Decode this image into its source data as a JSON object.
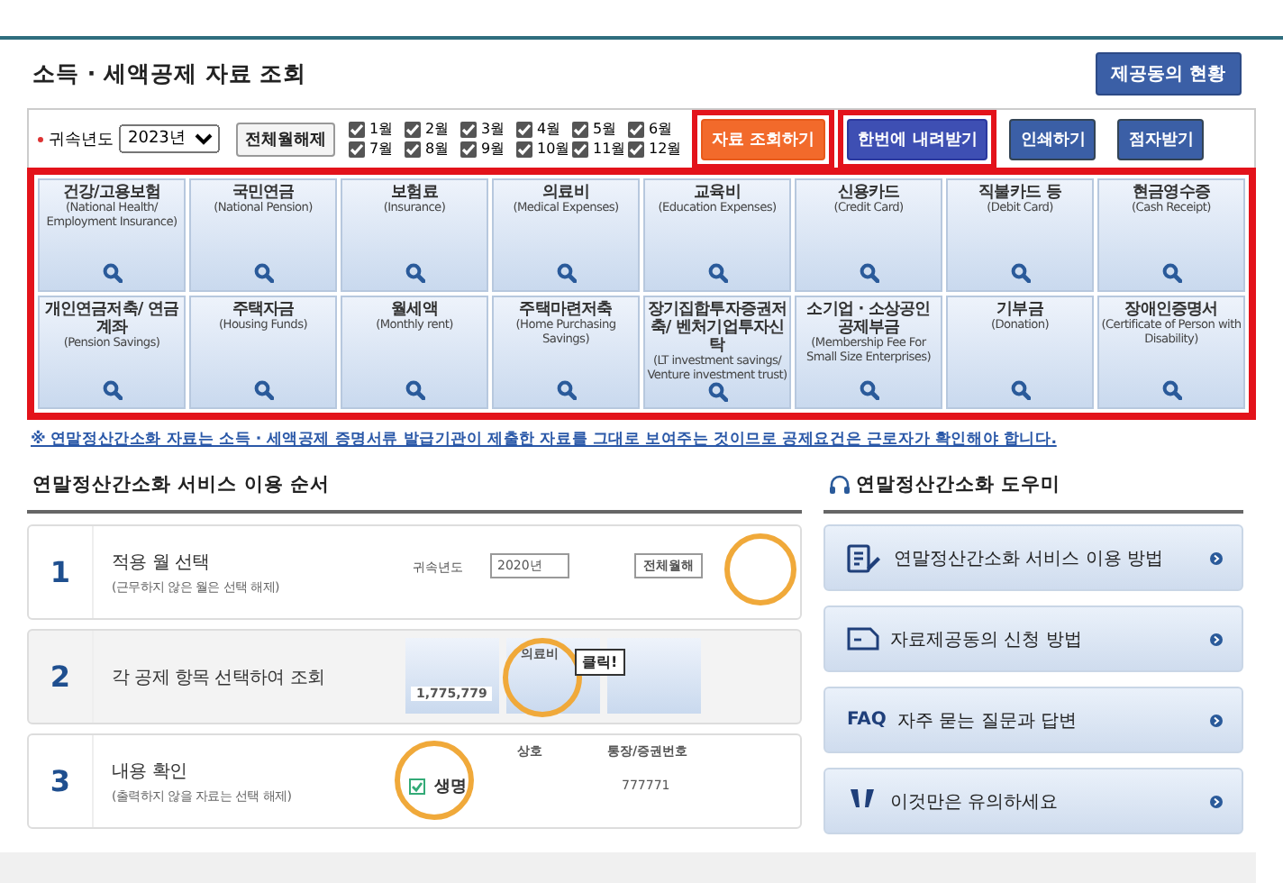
{
  "page": {
    "title": "소득 · 세액공제 자료 조회",
    "status_button": "제공동의 현황"
  },
  "query": {
    "required": true,
    "year_label": "귀속년도",
    "year": "2023년",
    "clear_button": "전체월해제",
    "months": [
      {
        "label": "1월",
        "checked": true
      },
      {
        "label": "2월",
        "checked": true
      },
      {
        "label": "3월",
        "checked": true
      },
      {
        "label": "4월",
        "checked": true
      },
      {
        "label": "5월",
        "checked": true
      },
      {
        "label": "6월",
        "checked": true
      },
      {
        "label": "7월",
        "checked": true
      },
      {
        "label": "8월",
        "checked": true
      },
      {
        "label": "9월",
        "checked": true
      },
      {
        "label": "10월",
        "checked": true
      },
      {
        "label": "11월",
        "checked": true
      },
      {
        "label": "12월",
        "checked": true
      }
    ],
    "buttons": [
      {
        "label": "자료 조회하기",
        "kind": "primary",
        "highlighted": true
      },
      {
        "label": "한번에 내려받기",
        "kind": "download",
        "highlighted": true
      },
      {
        "label": "인쇄하기",
        "kind": "normal",
        "highlighted": false
      },
      {
        "label": "점자받기",
        "kind": "normal",
        "highlighted": false
      }
    ]
  },
  "deductions": {
    "highlighted": true,
    "items": [
      {
        "name": "건강/고용보험",
        "english": "(National Health/ Employment Insurance)"
      },
      {
        "name": "국민연금",
        "english": "(National Pension)"
      },
      {
        "name": "보험료",
        "english": "(Insurance)"
      },
      {
        "name": "의료비",
        "english": "(Medical Expenses)"
      },
      {
        "name": "교육비",
        "english": "(Education Expenses)"
      },
      {
        "name": "신용카드",
        "english": "(Credit Card)"
      },
      {
        "name": "직불카드 등",
        "english": "(Debit Card)"
      },
      {
        "name": "현금영수증",
        "english": "(Cash Receipt)"
      },
      {
        "name": "개인연금저축/ 연금계좌",
        "english": "(Pension Savings)"
      },
      {
        "name": "주택자금",
        "english": "(Housing Funds)"
      },
      {
        "name": "월세액",
        "english": "(Monthly rent)"
      },
      {
        "name": "주택마련저축",
        "english": "(Home Purchasing Savings)"
      },
      {
        "name": "장기집합투자증권저축/ 벤처기업투자신탁",
        "english": "(LT investment savings/ Venture investment trust)"
      },
      {
        "name": "소기업 · 소상공인 공제부금",
        "english": "(Membership Fee For Small Size Enterprises)"
      },
      {
        "name": "기부금",
        "english": "(Donation)"
      },
      {
        "name": "장애인증명서",
        "english": "(Certificate of Person with Disability)"
      }
    ]
  },
  "notice": "※ 연말정산간소화 자료는 소득 · 세액공제 증명서류 발급기관이 제출한 자료를 그대로 보여주는 것이므로 공제요건은 근로자가 확인해야 합니다.",
  "guide": {
    "title": "연말정산간소화 서비스 이용 순서",
    "steps": [
      {
        "number": "1",
        "title": "적용 월 선택",
        "note": "(근무하지 않은 월은 선택 해제)",
        "kind": "months",
        "texts": [
          "귀속년도",
          "2020년",
          "전체월해"
        ]
      },
      {
        "number": "2",
        "title": "각 공제 항목 선택하여 조회",
        "kind": "items",
        "texts": [
          "1,775,779",
          "의료비",
          "클릭!"
        ]
      },
      {
        "number": "3",
        "title": "내용 확인",
        "note": "(출력하지 않을 자료는 선택 해제)",
        "kind": "table",
        "checked": true,
        "texts": [
          "상호",
          "통장/증권번호",
          "생명",
          "777771"
        ]
      }
    ]
  },
  "help": {
    "title": "연말정산간소화 도우미",
    "items": [
      {
        "label": "연말정산간소화 서비스 이용 방법",
        "kind": "document"
      },
      {
        "label": "자료제공동의 신청 방법",
        "kind": "form"
      },
      {
        "label": "자주 묻는 질문과 답변",
        "kind": "faq",
        "badge": "FAQ"
      },
      {
        "label": "이것만은 유의하세요",
        "kind": "alert"
      }
    ]
  }
}
